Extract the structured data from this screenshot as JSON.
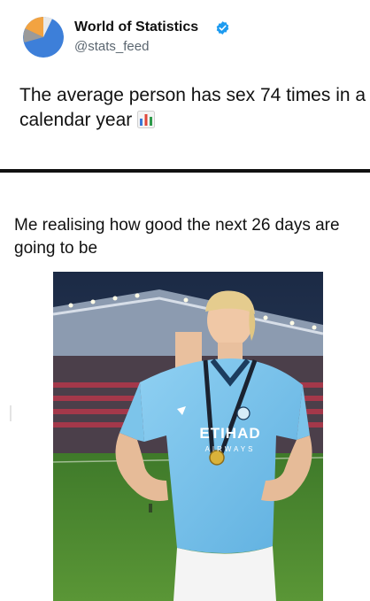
{
  "tweet": {
    "author_name": "World of Statistics",
    "author_handle": "@stats_feed",
    "text": "The average person has sex 74 times in a calendar year",
    "avatar_icon": "pie-chart-avatar-icon",
    "verified_icon": "verified-badge-icon",
    "emoji_icon": "bar-chart-emoji-icon",
    "colors": {
      "verified": "#1d9bf0",
      "handle": "#5b6670"
    }
  },
  "meme": {
    "caption": "Me realising how good the next 26 days are going to be",
    "photo": {
      "jersey_text": "ETIHAD",
      "jersey_subtext": "AIRWAYS",
      "jersey_color": "#7ec3ec",
      "pitch_color": "#4f8a2f"
    }
  }
}
